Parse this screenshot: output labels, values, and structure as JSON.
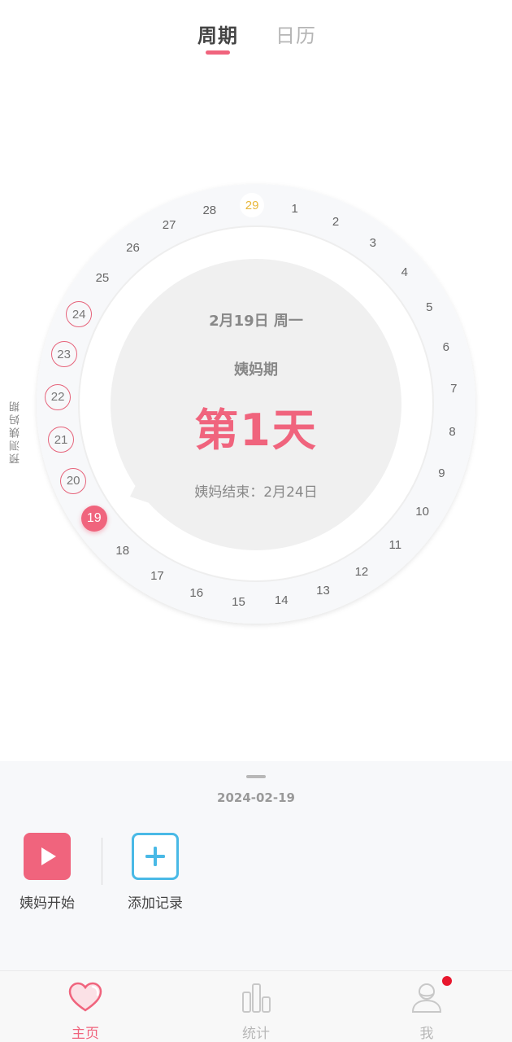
{
  "tabs": {
    "cycle": "周期",
    "calendar": "日历"
  },
  "ring": {
    "side_label": "预测姨妈期",
    "days": [
      {
        "n": "29",
        "state": "cycle-start"
      },
      {
        "n": "1",
        "state": "normal"
      },
      {
        "n": "2",
        "state": "normal"
      },
      {
        "n": "3",
        "state": "normal"
      },
      {
        "n": "4",
        "state": "normal"
      },
      {
        "n": "5",
        "state": "normal"
      },
      {
        "n": "6",
        "state": "normal"
      },
      {
        "n": "7",
        "state": "normal"
      },
      {
        "n": "8",
        "state": "normal"
      },
      {
        "n": "9",
        "state": "normal"
      },
      {
        "n": "10",
        "state": "normal"
      },
      {
        "n": "11",
        "state": "normal"
      },
      {
        "n": "12",
        "state": "normal"
      },
      {
        "n": "13",
        "state": "normal"
      },
      {
        "n": "14",
        "state": "normal"
      },
      {
        "n": "15",
        "state": "normal"
      },
      {
        "n": "16",
        "state": "normal"
      },
      {
        "n": "17",
        "state": "normal"
      },
      {
        "n": "18",
        "state": "normal"
      },
      {
        "n": "19",
        "state": "current"
      },
      {
        "n": "20",
        "state": "predicted"
      },
      {
        "n": "21",
        "state": "predicted"
      },
      {
        "n": "22",
        "state": "predicted"
      },
      {
        "n": "23",
        "state": "predicted"
      },
      {
        "n": "24",
        "state": "predicted"
      },
      {
        "n": "25",
        "state": "normal"
      },
      {
        "n": "26",
        "state": "normal"
      },
      {
        "n": "27",
        "state": "normal"
      },
      {
        "n": "28",
        "state": "normal"
      }
    ]
  },
  "center": {
    "date": "2月19日 周一",
    "phase": "姨妈期",
    "day": "第1天",
    "end": "姨妈结束：2月24日"
  },
  "panel": {
    "date": "2024-02-19",
    "start_label": "姨妈开始",
    "add_label": "添加记录"
  },
  "nav": {
    "home": "主页",
    "stats": "统计",
    "me": "我"
  },
  "colors": {
    "accent": "#f0647d",
    "add_blue": "#49b9e6",
    "cycle_start": "#e8b73a",
    "notification": "#e8172d"
  }
}
